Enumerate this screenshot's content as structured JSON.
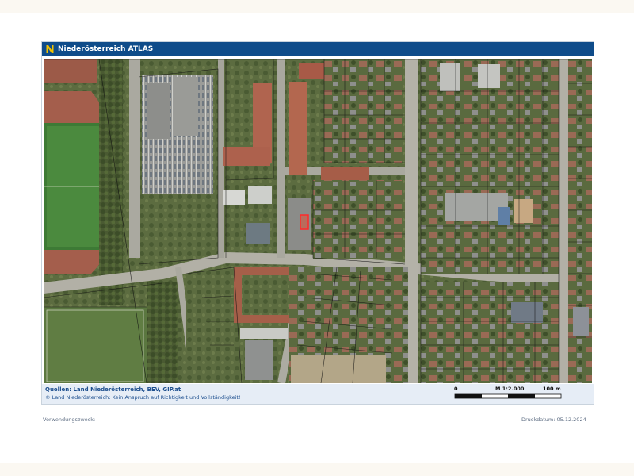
{
  "header": {
    "title": "Niederösterreich ATLAS",
    "logo_icon": "noe-n-logo-icon",
    "logo_letter": "N"
  },
  "map": {
    "content": "aerial imagery with cadastral parcel boundaries",
    "selected_parcel_color": "#ff2a2a"
  },
  "footer": {
    "sources": "Quellen: Land Niederösterreich, BEV, GIP.at",
    "disclaimer": "© Land Niederösterreich: Kein Anspruch auf Richtigkeit und Vollständigkeit!",
    "scale_start": "0",
    "scale_ratio": "M 1:2.000",
    "scale_end": "100 m"
  },
  "meta": {
    "purpose_label": "Verwendungszweck:",
    "print_date": "Druckdatum: 05.12.2024"
  },
  "colors": {
    "header_bg": "#0f4c8a",
    "footer_bg": "#e6edf6",
    "logo_yellow": "#f2c200"
  }
}
